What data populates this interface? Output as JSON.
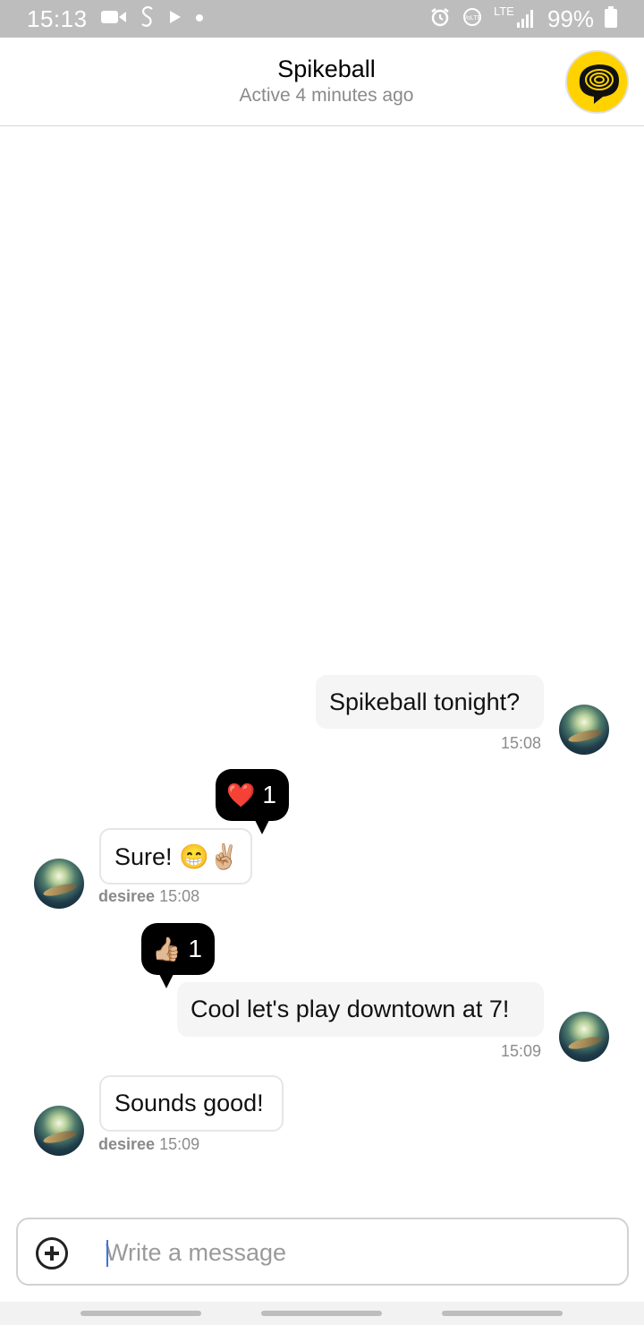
{
  "status_bar": {
    "time": "15:13",
    "battery": "99%",
    "network": "LTE",
    "volte": "VoLTE"
  },
  "header": {
    "title": "Spikeball",
    "subtitle": "Active 4 minutes ago"
  },
  "messages": [
    {
      "direction": "outgoing",
      "text": "Spikeball tonight?",
      "time": "15:08"
    },
    {
      "direction": "incoming",
      "text": "Sure! 😁✌🏼",
      "author": "desiree",
      "time": "15:08",
      "reaction": {
        "emoji": "❤️",
        "count": "1"
      }
    },
    {
      "direction": "outgoing",
      "text": "Cool let's play downtown at 7!",
      "time": "15:09",
      "reaction": {
        "emoji": "👍🏼",
        "count": "1"
      }
    },
    {
      "direction": "incoming",
      "text": "Sounds good!",
      "author": "desiree",
      "time": "15:09"
    }
  ],
  "composer": {
    "placeholder": "Write a message"
  },
  "colors": {
    "status_bar_bg": "#bdbdbd",
    "outgoing_bubble": "#f5f5f5",
    "incoming_bubble_border": "#e6e6e6",
    "reaction_bg": "#000000",
    "caret": "#3a74e0"
  }
}
